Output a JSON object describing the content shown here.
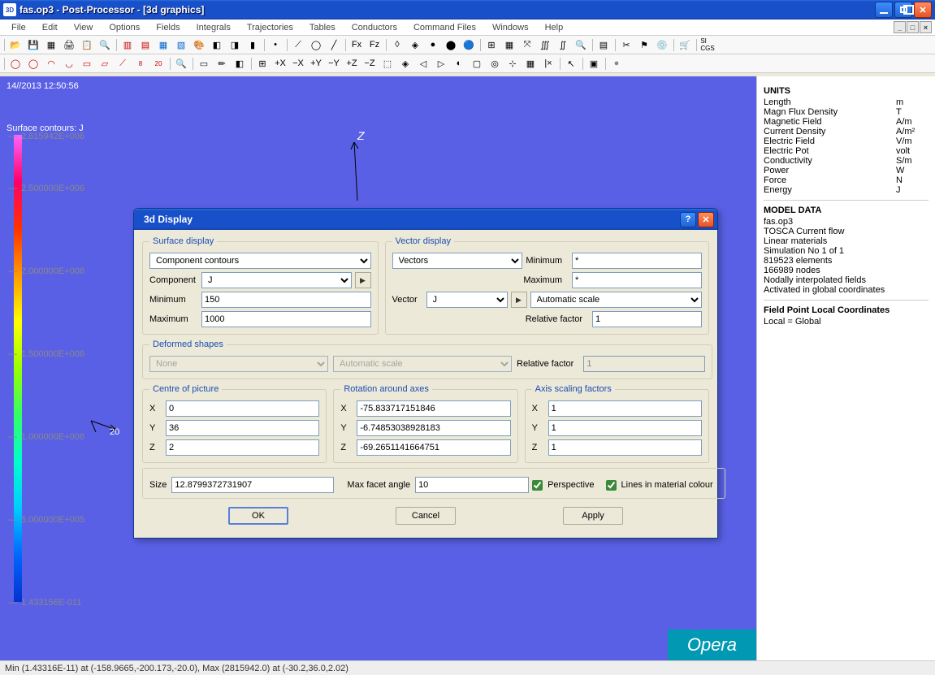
{
  "window": {
    "title": "fas.op3 - Post-Processor  - [3d graphics]"
  },
  "menu": [
    "File",
    "Edit",
    "View",
    "Options",
    "Fields",
    "Integrals",
    "Trajectories",
    "Tables",
    "Conductors",
    "Command Files",
    "Windows",
    "Help"
  ],
  "viewport": {
    "timestamp": "14//2013 12:50:56",
    "sc_label": "Surface contours: J",
    "ticks": [
      "2.815942E+006",
      "2.500000E+006",
      "2.000000E+006",
      "1.500000E+006",
      "1.000000E+006",
      "5.000000E+005",
      "1.433156E-011"
    ],
    "axis_z": "Z",
    "axis_small": "20",
    "brand": "Opera"
  },
  "info": {
    "units_h": "UNITS",
    "units": [
      [
        "Length",
        "m"
      ],
      [
        "Magn Flux Density",
        "T"
      ],
      [
        "Magnetic Field",
        "A/m"
      ],
      [
        "Current Density",
        "A/m²"
      ],
      [
        "Electric Field",
        "V/m"
      ],
      [
        "Electric Pot",
        "volt"
      ],
      [
        "Conductivity",
        "S/m"
      ],
      [
        "Power",
        "W"
      ],
      [
        "Force",
        "N"
      ],
      [
        "Energy",
        "J"
      ]
    ],
    "model_h": "MODEL DATA",
    "model": [
      "fas.op3",
      "TOSCA Current flow",
      "Linear materials",
      "Simulation No 1 of 1",
      "819523 elements",
      "166989 nodes",
      "Nodally interpolated fields",
      "Activated in global coordinates"
    ],
    "fplc_h": "Field Point Local Coordinates",
    "fplc": "Local = Global"
  },
  "status": {
    "text": "Min (1.43316E-11) at (-158.9665,-200.173,-20.0), Max (2815942.0) at (-30.2,36.0,2.02)"
  },
  "dialog": {
    "title": "3d Display",
    "surface": {
      "legend": "Surface display",
      "type_val": "Component contours",
      "comp_label": "Component",
      "comp_val": "J",
      "min_label": "Minimum",
      "min_val": "150",
      "max_label": "Maximum",
      "max_val": "1000"
    },
    "vector": {
      "legend": "Vector display",
      "type_val": "Vectors",
      "min_label": "Minimum",
      "min_val": "*",
      "max_label": "Maximum",
      "max_val": "*",
      "vec_label": "Vector",
      "vec_val": "J",
      "scale_val": "Automatic scale",
      "rel_label": "Relative factor",
      "rel_val": "1"
    },
    "deformed": {
      "legend": "Deformed shapes",
      "shape_val": "None",
      "scale_val": "Automatic scale",
      "rel_label": "Relative factor",
      "rel_val": "1"
    },
    "centre": {
      "legend": "Centre of picture",
      "x": "0",
      "y": "36",
      "z": "2"
    },
    "rotation": {
      "legend": "Rotation around axes",
      "x": "-75.833717151846",
      "y": "-6.74853038928183",
      "z": "-69.2651141664751"
    },
    "scaling": {
      "legend": "Axis scaling factors",
      "x": "1",
      "y": "1",
      "z": "1"
    },
    "size_label": "Size",
    "size_val": "12.8799372731907",
    "facet_label": "Max facet angle",
    "facet_val": "10",
    "perspective": "Perspective",
    "lines": "Lines in material colour",
    "ok": "OK",
    "cancel": "Cancel",
    "apply": "Apply"
  }
}
